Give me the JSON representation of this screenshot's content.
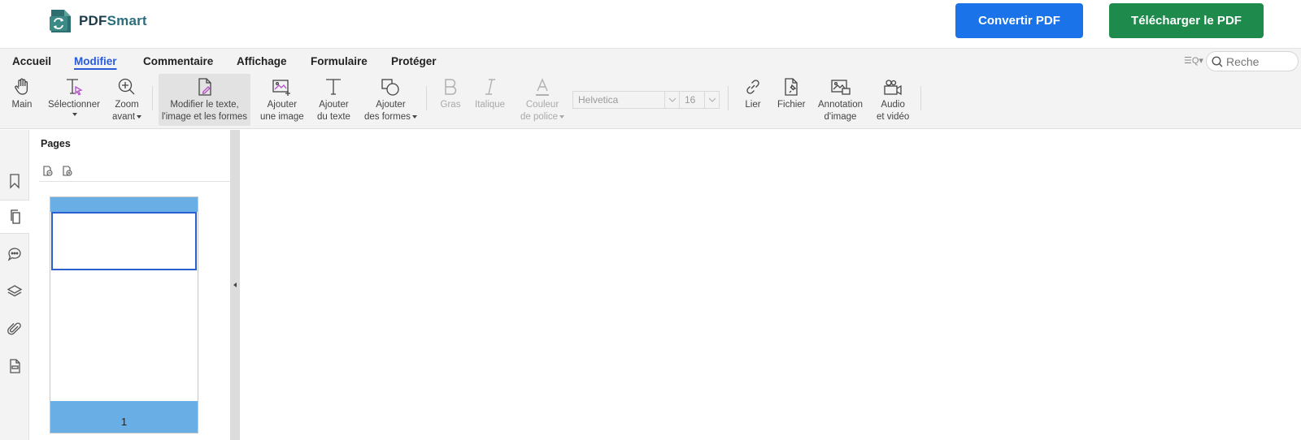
{
  "header": {
    "logo_prefix": "PDF",
    "logo_suffix": "Smart",
    "convert_label": "Convertir PDF",
    "download_label": "Télécharger le PDF",
    "colors": {
      "convert": "#1a73e8",
      "download": "#1e8a4c"
    }
  },
  "menu": {
    "items": [
      {
        "label": "Accueil"
      },
      {
        "label": "Modifier",
        "active": true
      },
      {
        "label": "Commentaire"
      },
      {
        "label": "Affichage"
      },
      {
        "label": "Formulaire"
      },
      {
        "label": "Protéger"
      }
    ]
  },
  "search": {
    "placeholder": "Reche"
  },
  "toolbar": {
    "main": "Main",
    "select_1": "Sélectionner",
    "zoom_1": "Zoom",
    "zoom_2": "avant",
    "edit_1": "Modifier le texte,",
    "edit_2": "l'image et les formes",
    "addimg_1": "Ajouter",
    "addimg_2": "une image",
    "addtext_1": "Ajouter",
    "addtext_2": "du texte",
    "addshape_1": "Ajouter",
    "addshape_2": "des formes",
    "bold": "Gras",
    "italic": "Italique",
    "fontcolor_1": "Couleur",
    "fontcolor_2": "de police",
    "font_family": "Helvetica",
    "font_size": "16",
    "link": "Lier",
    "file": "Fichier",
    "annot_1": "Annotation",
    "annot_2": "d'image",
    "av_1": "Audio",
    "av_2": "et vidéo"
  },
  "sidebar": {
    "icons": [
      "bookmark-icon",
      "pages-icon",
      "comments-icon",
      "layers-icon",
      "attachment-icon",
      "form-fields-icon"
    ],
    "active": "pages-icon"
  },
  "pages_panel": {
    "title": "Pages",
    "thumbnails": [
      {
        "page_number": "1"
      }
    ]
  }
}
